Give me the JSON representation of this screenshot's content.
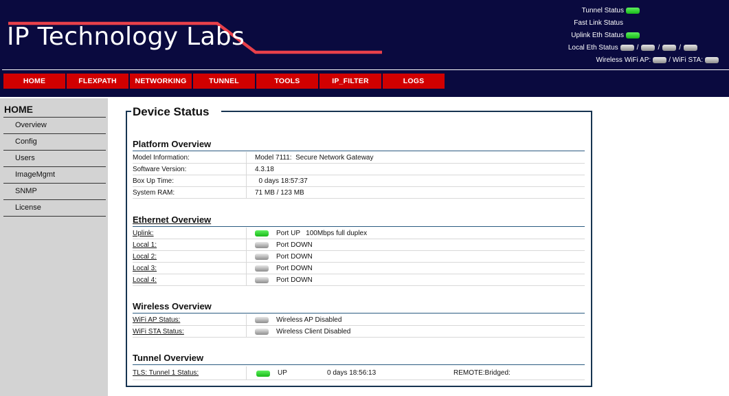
{
  "brand": {
    "logo_text": "IP Technology Labs"
  },
  "colors": {
    "header_bg": "#0a0a3f",
    "nav_bg": "#d10000",
    "swoosh": "#e8404a",
    "panel_border": "#163350",
    "led_up": "#22c022",
    "led_down": "#a0a0a0"
  },
  "status": {
    "tunnel": {
      "label": "Tunnel Status",
      "state": "up"
    },
    "fast_link": {
      "label": "Fast Link Status"
    },
    "uplink_eth": {
      "label": "Uplink Eth Status",
      "state": "up"
    },
    "local_eth": {
      "label": "Local Eth Status",
      "states": [
        "down",
        "down",
        "down",
        "down"
      ],
      "separator": "/"
    },
    "wireless": {
      "label": "Wireless",
      "wifi_ap_label": "WiFi AP:",
      "wifi_sta_label": "/ WiFi STA:",
      "ap_state": "down",
      "sta_state": "down"
    }
  },
  "nav": [
    "HOME",
    "FLEXPATH",
    "NETWORKING",
    "TUNNEL",
    "TOOLS",
    "IP_FILTER",
    "LOGS"
  ],
  "sidebar": {
    "title": "HOME",
    "items": [
      "Overview",
      "Config",
      "Users",
      "ImageMgmt",
      "SNMP",
      "License"
    ]
  },
  "main": {
    "title": "Device Status",
    "platform": {
      "title": "Platform Overview",
      "rows": [
        {
          "label": "Model Information:",
          "value": "Model 7111:  Secure Network Gateway"
        },
        {
          "label": "Software Version:",
          "value": "4.3.18"
        },
        {
          "label": "Box Up Time:",
          "value": "  0 days 18:57:37"
        },
        {
          "label": "System RAM:",
          "value": "71 MB / 123 MB"
        }
      ]
    },
    "ethernet": {
      "title": "Ethernet Overview",
      "rows": [
        {
          "label": "Uplink:",
          "state": "up",
          "value": "Port UP   100Mbps full duplex"
        },
        {
          "label": "Local 1:",
          "state": "down",
          "value": "Port DOWN"
        },
        {
          "label": "Local 2:",
          "state": "down",
          "value": "Port DOWN"
        },
        {
          "label": "Local 3:",
          "state": "down",
          "value": "Port DOWN"
        },
        {
          "label": "Local 4:",
          "state": "down",
          "value": "Port DOWN"
        }
      ]
    },
    "wireless": {
      "title": "Wireless Overview",
      "rows": [
        {
          "label": "WiFi AP Status:",
          "state": "down",
          "value": "Wireless AP Disabled"
        },
        {
          "label": "WiFi STA Status:",
          "state": "down",
          "value": "Wireless Client Disabled"
        }
      ]
    },
    "tunnel": {
      "title": "Tunnel Overview",
      "row": {
        "label": "TLS: Tunnel 1 Status:",
        "state": "up",
        "status": "UP",
        "uptime": "0 days 18:56:13",
        "remote": "REMOTE:Bridged:"
      }
    }
  }
}
